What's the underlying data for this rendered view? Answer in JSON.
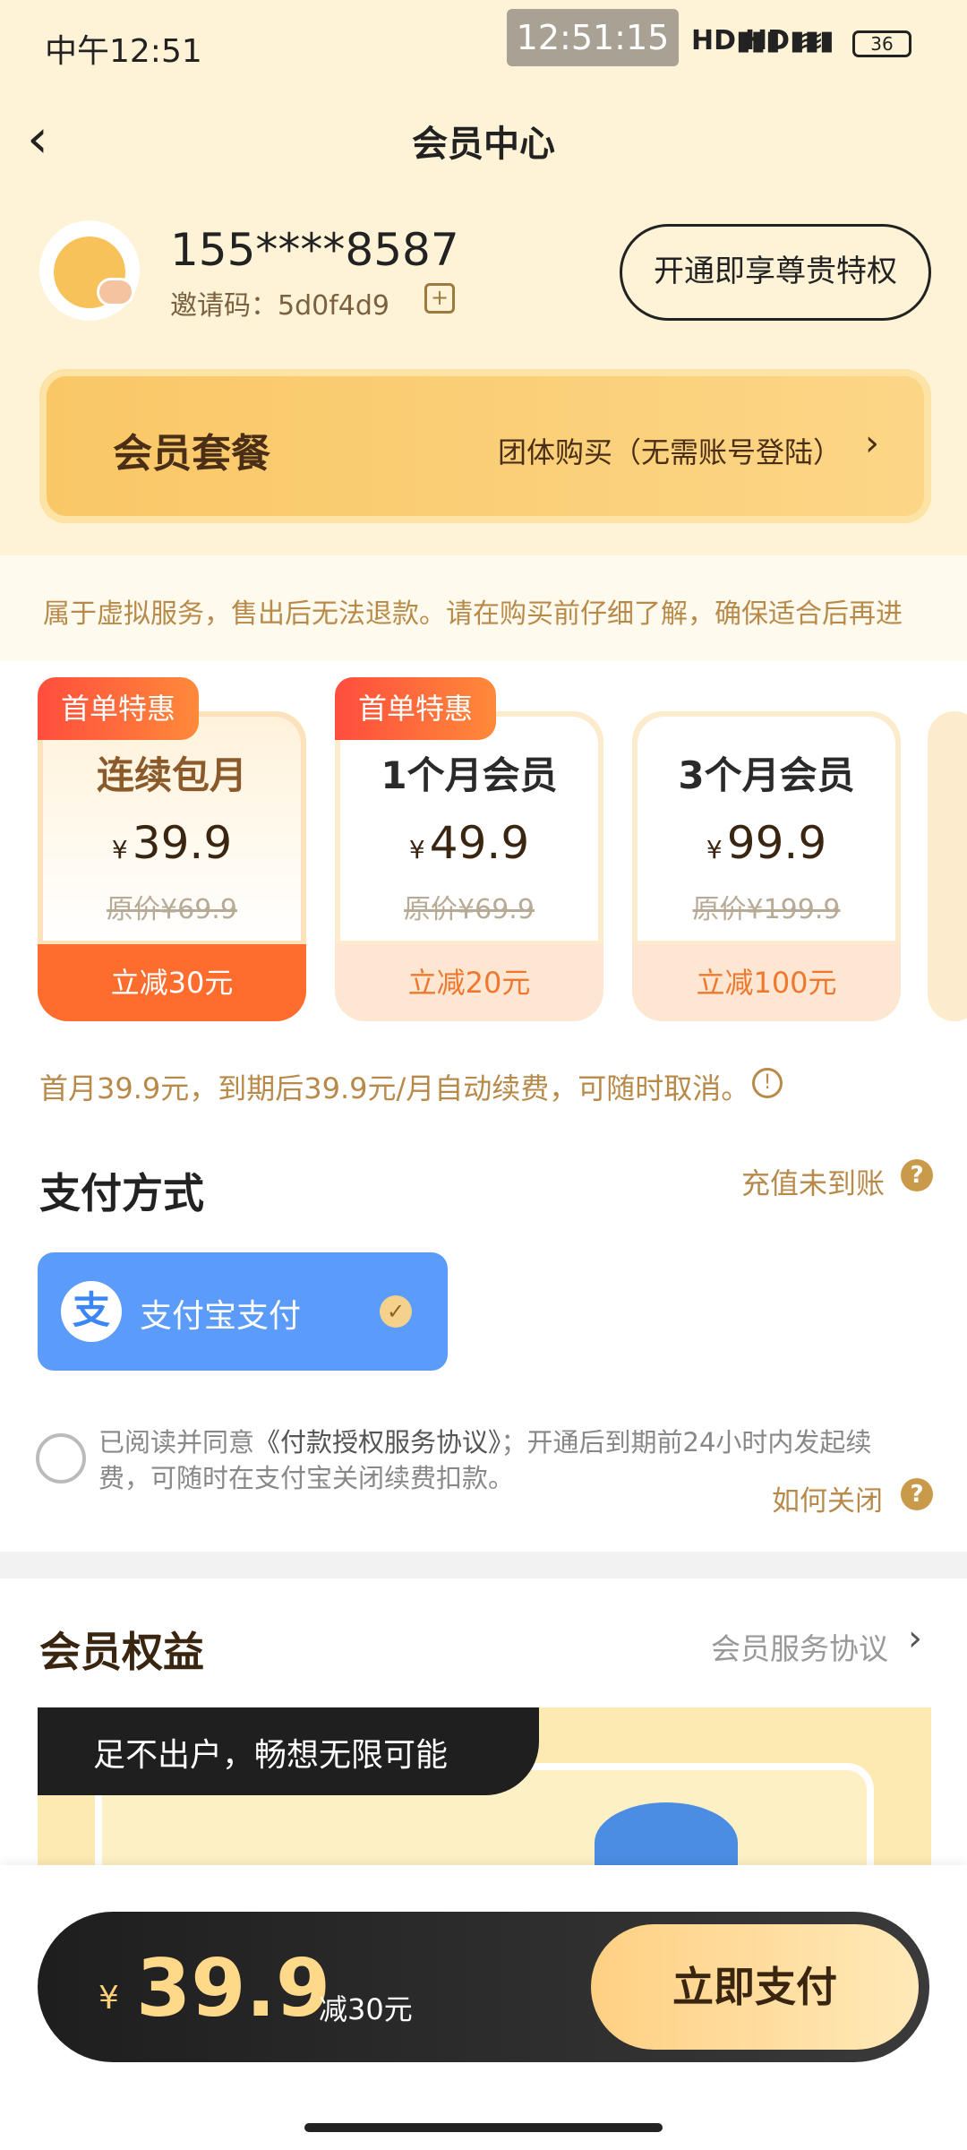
{
  "status_bar": {
    "time": "中午12:51",
    "clock_pill": "12:51:15",
    "signal1": "HD▮▮▮",
    "signal2": "HD▮▮▮",
    "wifi": "≋",
    "battery": "36"
  },
  "header": {
    "title": "会员中心",
    "back_icon": "‹"
  },
  "user": {
    "phone": "155****8587",
    "invite_label": "邀请码：5d0f4d9",
    "copy_icon": "+",
    "privilege_button": "开通即享尊贵特权"
  },
  "plan_banner": {
    "title": "会员套餐",
    "group_buy": "团体购买（无需账号登陆）",
    "chevron": "›"
  },
  "notice": "属于虚拟服务，售出后无法退款。请在购买前仔细了解，确保适合后再进",
  "plans": [
    {
      "badge": "首单特惠",
      "name": "连续包月",
      "currency": "¥",
      "price": "39.9",
      "original": "原价¥69.9",
      "discount": "立减30元"
    },
    {
      "badge": "首单特惠",
      "name": "1个月会员",
      "currency": "¥",
      "price": "49.9",
      "original": "原价¥69.9",
      "discount": "立减20元"
    },
    {
      "badge": "",
      "name": "3个月会员",
      "currency": "¥",
      "price": "99.9",
      "original": "原价¥199.9",
      "discount": "立减100元"
    }
  ],
  "renewal_note": "首月39.9元，到期后39.9元/月自动续费，可随时取消。",
  "info_icon": "!",
  "payment": {
    "title": "支付方式",
    "recharge_link": "充值未到账",
    "help_icon": "?",
    "alipay_logo": "支",
    "alipay_label": "支付宝支付",
    "check_icon": "✓"
  },
  "agreement": {
    "prefix": "已阅读并同意",
    "link": "《付款授权服务协议》",
    "suffix": "；开通后到期前24小时内发起续费，可随时在支付宝关闭续费扣款。",
    "close_link": "如何关闭",
    "help_icon": "?"
  },
  "benefits": {
    "title": "会员权益",
    "service_link": "会员服务协议",
    "chevron": "›",
    "card_label": "足不出户，畅想无限可能"
  },
  "bottom_bar": {
    "currency": "¥",
    "amount": "39.9",
    "discount": "减30元",
    "pay_button": "立即支付"
  },
  "colors": {
    "header_bg": "#fef3d6",
    "accent_orange": "#ff6d2e",
    "gold_text": "#b88a4a",
    "alipay_blue": "#5b9bfa"
  }
}
